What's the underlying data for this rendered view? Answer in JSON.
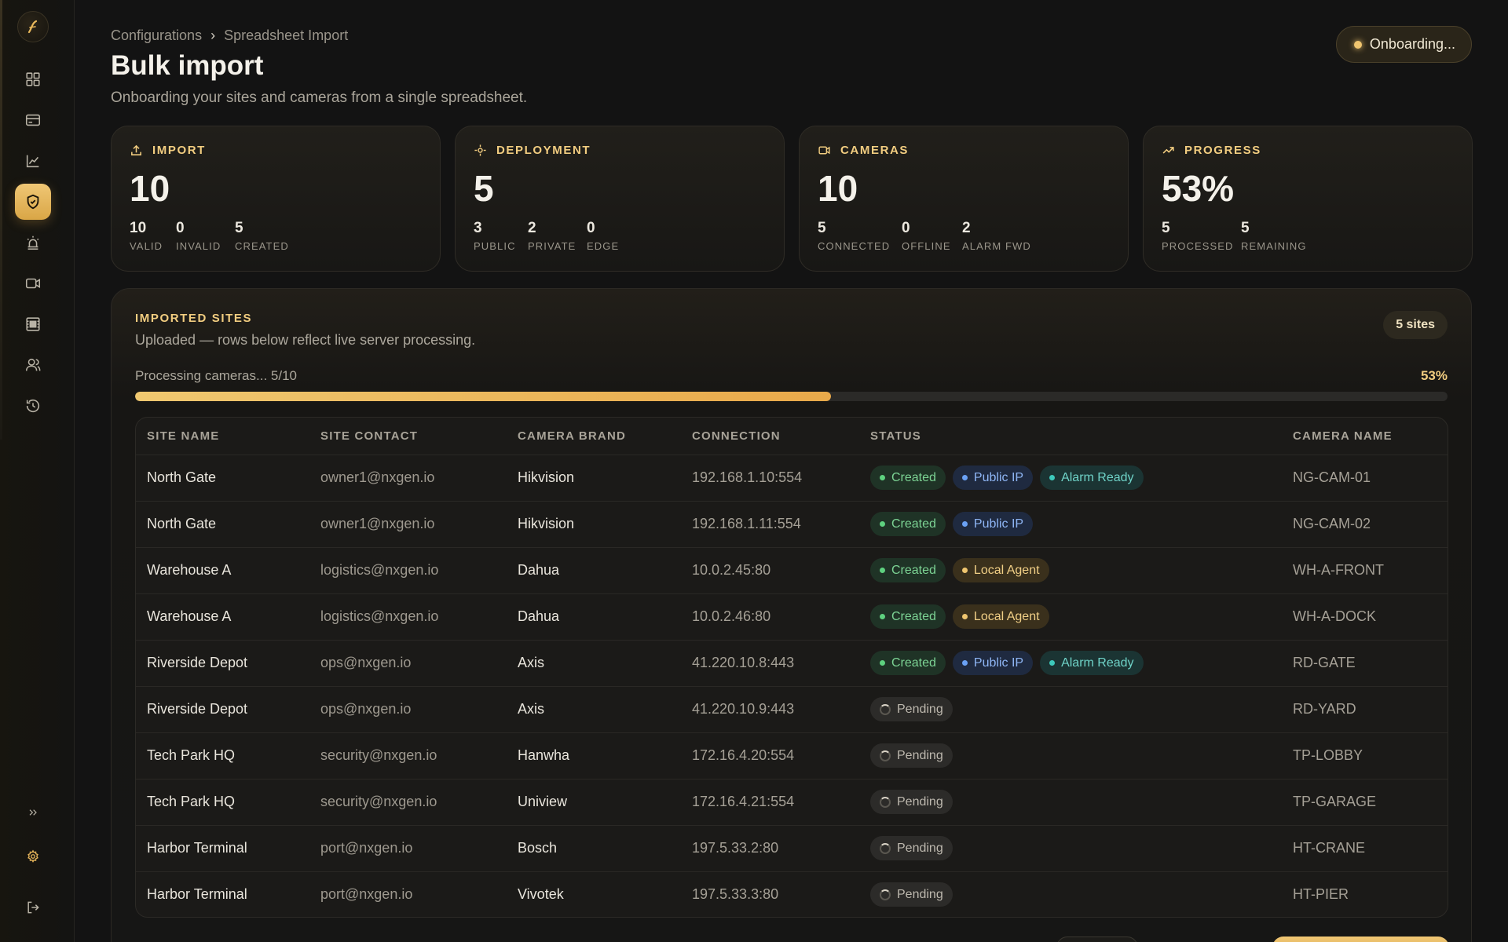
{
  "breadcrumb": {
    "parent": "Configurations",
    "separator": "›",
    "current": "Spreadsheet Import"
  },
  "page": {
    "title": "Bulk import",
    "subtitle": "Onboarding your sites and cameras from a single spreadsheet."
  },
  "status": {
    "label": "Onboarding..."
  },
  "stats": [
    {
      "title": "IMPORT",
      "icon": "upload-icon",
      "value": "10",
      "subs": [
        {
          "num": "10",
          "label": "VALID"
        },
        {
          "num": "0",
          "label": "INVALID"
        },
        {
          "num": "5",
          "label": "CREATED"
        }
      ]
    },
    {
      "title": "DEPLOYMENT",
      "icon": "deploy-icon",
      "value": "5",
      "subs": [
        {
          "num": "3",
          "label": "PUBLIC"
        },
        {
          "num": "2",
          "label": "PRIVATE"
        },
        {
          "num": "0",
          "label": "EDGE"
        }
      ]
    },
    {
      "title": "CAMERAS",
      "icon": "camera-icon",
      "value": "10",
      "subs": [
        {
          "num": "5",
          "label": "CONNECTED"
        },
        {
          "num": "0",
          "label": "OFFLINE"
        },
        {
          "num": "2",
          "label": "ALARM FWD"
        }
      ]
    },
    {
      "title": "PROGRESS",
      "icon": "trend-icon",
      "value": "53%",
      "subs": [
        {
          "num": "5",
          "label": "PROCESSED"
        },
        {
          "num": "5",
          "label": "REMAINING"
        }
      ]
    }
  ],
  "panel": {
    "title": "IMPORTED SITES",
    "subtitle": "Uploaded — rows below reflect live server processing.",
    "count": "5 sites",
    "progress_label": "Processing cameras... 5/10",
    "progress_pct": "53%",
    "progress_fraction": 0.53
  },
  "table": {
    "headers": [
      "SITE NAME",
      "SITE CONTACT",
      "CAMERA BRAND",
      "CONNECTION",
      "STATUS",
      "CAMERA NAME"
    ],
    "rows": [
      {
        "site": "North Gate",
        "contact": "owner1@nxgen.io",
        "brand": "Hikvision",
        "conn": "192.168.1.10:554",
        "badges": [
          "Created",
          "Public IP",
          "Alarm Ready"
        ],
        "camera": "NG-CAM-01"
      },
      {
        "site": "North Gate",
        "contact": "owner1@nxgen.io",
        "brand": "Hikvision",
        "conn": "192.168.1.11:554",
        "badges": [
          "Created",
          "Public IP"
        ],
        "camera": "NG-CAM-02"
      },
      {
        "site": "Warehouse A",
        "contact": "logistics@nxgen.io",
        "brand": "Dahua",
        "conn": "10.0.2.45:80",
        "badges": [
          "Created",
          "Local Agent"
        ],
        "camera": "WH-A-FRONT"
      },
      {
        "site": "Warehouse A",
        "contact": "logistics@nxgen.io",
        "brand": "Dahua",
        "conn": "10.0.2.46:80",
        "badges": [
          "Created",
          "Local Agent"
        ],
        "camera": "WH-A-DOCK"
      },
      {
        "site": "Riverside Depot",
        "contact": "ops@nxgen.io",
        "brand": "Axis",
        "conn": "41.220.10.8:443",
        "badges": [
          "Created",
          "Public IP",
          "Alarm Ready"
        ],
        "camera": "RD-GATE"
      },
      {
        "site": "Riverside Depot",
        "contact": "ops@nxgen.io",
        "brand": "Axis",
        "conn": "41.220.10.9:443",
        "badges": [
          "Pending"
        ],
        "camera": "RD-YARD"
      },
      {
        "site": "Tech Park HQ",
        "contact": "security@nxgen.io",
        "brand": "Hanwha",
        "conn": "172.16.4.20:554",
        "badges": [
          "Pending"
        ],
        "camera": "TP-LOBBY"
      },
      {
        "site": "Tech Park HQ",
        "contact": "security@nxgen.io",
        "brand": "Uniview",
        "conn": "172.16.4.21:554",
        "badges": [
          "Pending"
        ],
        "camera": "TP-GARAGE"
      },
      {
        "site": "Harbor Terminal",
        "contact": "port@nxgen.io",
        "brand": "Bosch",
        "conn": "197.5.33.2:80",
        "badges": [
          "Pending"
        ],
        "camera": "HT-CRANE"
      },
      {
        "site": "Harbor Terminal",
        "contact": "port@nxgen.io",
        "brand": "Vivotek",
        "conn": "197.5.33.3:80",
        "badges": [
          "Pending"
        ],
        "camera": "HT-PIER"
      }
    ]
  },
  "sidebar": {
    "active_index": 3,
    "items": [
      {
        "icon": "dashboard-icon"
      },
      {
        "icon": "card-icon"
      },
      {
        "icon": "chart-icon"
      },
      {
        "icon": "shield-check-icon"
      },
      {
        "icon": "siren-icon"
      },
      {
        "icon": "video-icon"
      },
      {
        "icon": "grid-icon"
      },
      {
        "icon": "users-icon"
      },
      {
        "icon": "history-icon"
      }
    ],
    "footer": [
      {
        "icon": "expand-icon"
      },
      {
        "icon": "settings-icon"
      },
      {
        "icon": "logout-icon"
      }
    ]
  }
}
